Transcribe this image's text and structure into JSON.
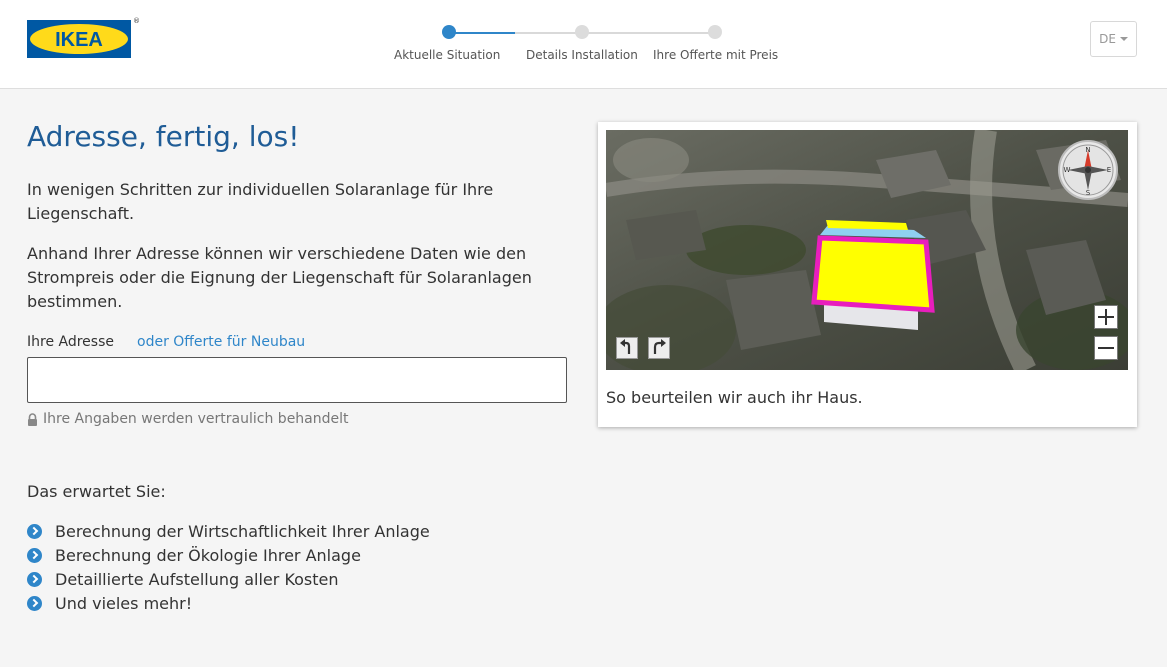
{
  "header": {
    "logo_text": "IKEA",
    "logo_reg": "®",
    "steps": [
      {
        "label": "Aktuelle Situation",
        "active": true
      },
      {
        "label": "Details Installation",
        "active": false
      },
      {
        "label": "Ihre Offerte mit Preis",
        "active": false
      }
    ],
    "language": "DE"
  },
  "main": {
    "title": "Adresse, fertig, los!",
    "intro": "In wenigen Schritten zur individuellen Solaranlage für Ihre Liegenschaft.",
    "description": "Anhand Ihrer Adresse können wir verschiedene Daten wie den Strompreis oder die Eignung der Liegenschaft für Solaranlagen bestimmen.",
    "address_label": "Ihre Adresse",
    "new_build_link": "oder Offerte für Neubau",
    "address_value": "",
    "privacy_note": "Ihre Angaben werden vertraulich behandelt",
    "expect_title": "Das erwartet Sie:",
    "expect_items": [
      "Berechnung der Wirtschaftlichkeit Ihrer Anlage",
      "Berechnung der Ökologie Ihrer Anlage",
      "Detaillierte Aufstellung aller Kosten",
      "Und vieles mehr!"
    ]
  },
  "preview": {
    "caption": "So beurteilen wir auch ihr Haus.",
    "compass_letters": {
      "n": "N",
      "e": "E",
      "s": "S",
      "w": "W"
    }
  },
  "colors": {
    "accent": "#2f86c9",
    "title": "#1f5c96",
    "roof_fill": "#ffff00",
    "roof_outline": "#e81ebd",
    "ikea_blue": "#0058a3",
    "ikea_yellow": "#ffda1a"
  }
}
